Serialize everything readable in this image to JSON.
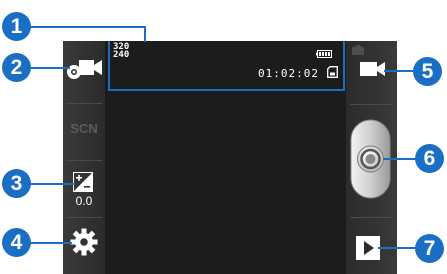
{
  "viewfinder": {
    "resolution_width": "320",
    "resolution_height": "240",
    "recording_time": "01:02:02"
  },
  "left_panel": {
    "mode_icon": "camcorder-mode-icon",
    "scene_label": "SCN",
    "exposure_icon": "exposure-icon",
    "exposure_value": "0.0",
    "settings_icon": "gear-icon"
  },
  "right_panel": {
    "switch_icon": "camcorder-icon",
    "shutter_icon": "record-button",
    "playback_icon": "play-icon"
  },
  "callouts": [
    "1",
    "2",
    "3",
    "4",
    "5",
    "6",
    "7"
  ],
  "colors": {
    "callout": "#1a6fc4",
    "screen": "#1c1c1c",
    "panel": "#333333"
  }
}
